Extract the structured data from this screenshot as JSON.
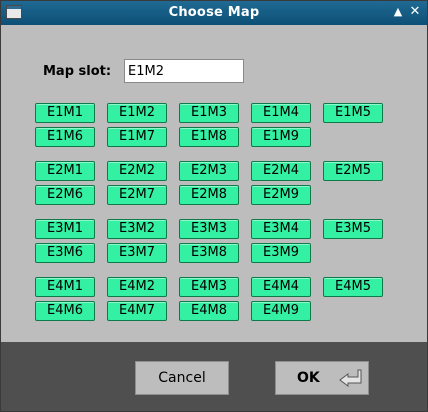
{
  "window": {
    "title": "Choose Map",
    "shade_icon": "▲",
    "close_icon": "✕"
  },
  "slot": {
    "label": "Map slot:",
    "value": "E1M2"
  },
  "episodes": [
    [
      "E1M1",
      "E1M2",
      "E1M3",
      "E1M4",
      "E1M5",
      "E1M6",
      "E1M7",
      "E1M8",
      "E1M9"
    ],
    [
      "E2M1",
      "E2M2",
      "E2M3",
      "E2M4",
      "E2M5",
      "E2M6",
      "E2M7",
      "E2M8",
      "E2M9"
    ],
    [
      "E3M1",
      "E3M2",
      "E3M3",
      "E3M4",
      "E3M5",
      "E3M6",
      "E3M7",
      "E3M8",
      "E3M9"
    ],
    [
      "E4M1",
      "E4M2",
      "E4M3",
      "E4M4",
      "E4M5",
      "E4M6",
      "E4M7",
      "E4M8",
      "E4M9"
    ]
  ],
  "buttons": {
    "cancel": "Cancel",
    "ok": "OK"
  },
  "colors": {
    "titlebar": "#0d4f76",
    "map_button": "#33f0a2",
    "dialog_bg": "#bdbdbd",
    "footer_bg": "#4f4f4f"
  }
}
